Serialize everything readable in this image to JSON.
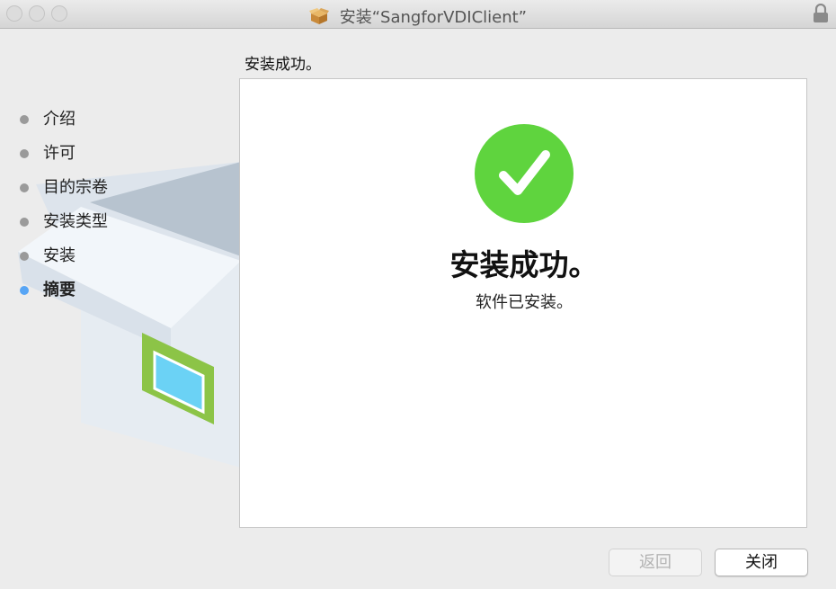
{
  "window": {
    "title": "安装“SangforVDIClient”",
    "title_icon": "package-icon",
    "lock_icon": "lock-icon"
  },
  "sidebar": {
    "steps": [
      {
        "label": "介绍",
        "state": "done"
      },
      {
        "label": "许可",
        "state": "done"
      },
      {
        "label": "目的宗卷",
        "state": "done"
      },
      {
        "label": "安装类型",
        "state": "done"
      },
      {
        "label": "安装",
        "state": "done"
      },
      {
        "label": "摘要",
        "state": "current"
      }
    ]
  },
  "main": {
    "heading": "安装成功。",
    "status_icon": "checkmark-circle-icon",
    "success_title": "安装成功。",
    "success_subtitle": "软件已安装。"
  },
  "buttons": {
    "back_label": "返回",
    "back_enabled": false,
    "close_label": "关闭"
  },
  "colors": {
    "success_green": "#5fd43e",
    "active_step_dot": "#57a5f5",
    "inactive_step_dot": "#9a9a9a"
  }
}
